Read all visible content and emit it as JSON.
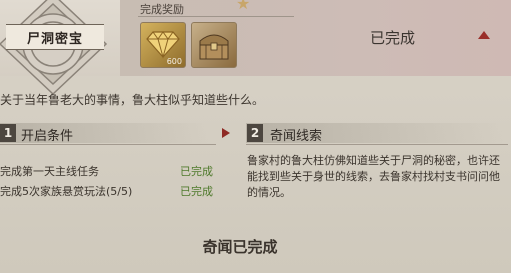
{
  "header": {
    "title": "尸洞密宝",
    "reward_label": "完成奖励",
    "status": "已完成",
    "rewards": [
      {
        "icon": "gold-diamond-icon",
        "quantity": "600"
      },
      {
        "icon": "treasure-chest-icon"
      }
    ]
  },
  "description": "关于当年鲁老大的事情，鲁大柱似乎知道些什么。",
  "conditions": {
    "number": "1",
    "title": "开启条件",
    "items": [
      {
        "text": "完成第一天主线任务",
        "status": "已完成"
      },
      {
        "text": "完成5次家族悬赏玩法(5/5)",
        "status": "已完成"
      }
    ]
  },
  "clues": {
    "number": "2",
    "title": "奇闻线索",
    "text": "鲁家村的鲁大柱仿佛知道些关于尸洞的秘密，也许还能找到些关于身世的线索，去鲁家村找村支书问问他的情况。"
  },
  "footer_status": "奇闻已完成",
  "colors": {
    "accent_red": "#9a2f2a",
    "complete_green": "#4f7a2c"
  }
}
